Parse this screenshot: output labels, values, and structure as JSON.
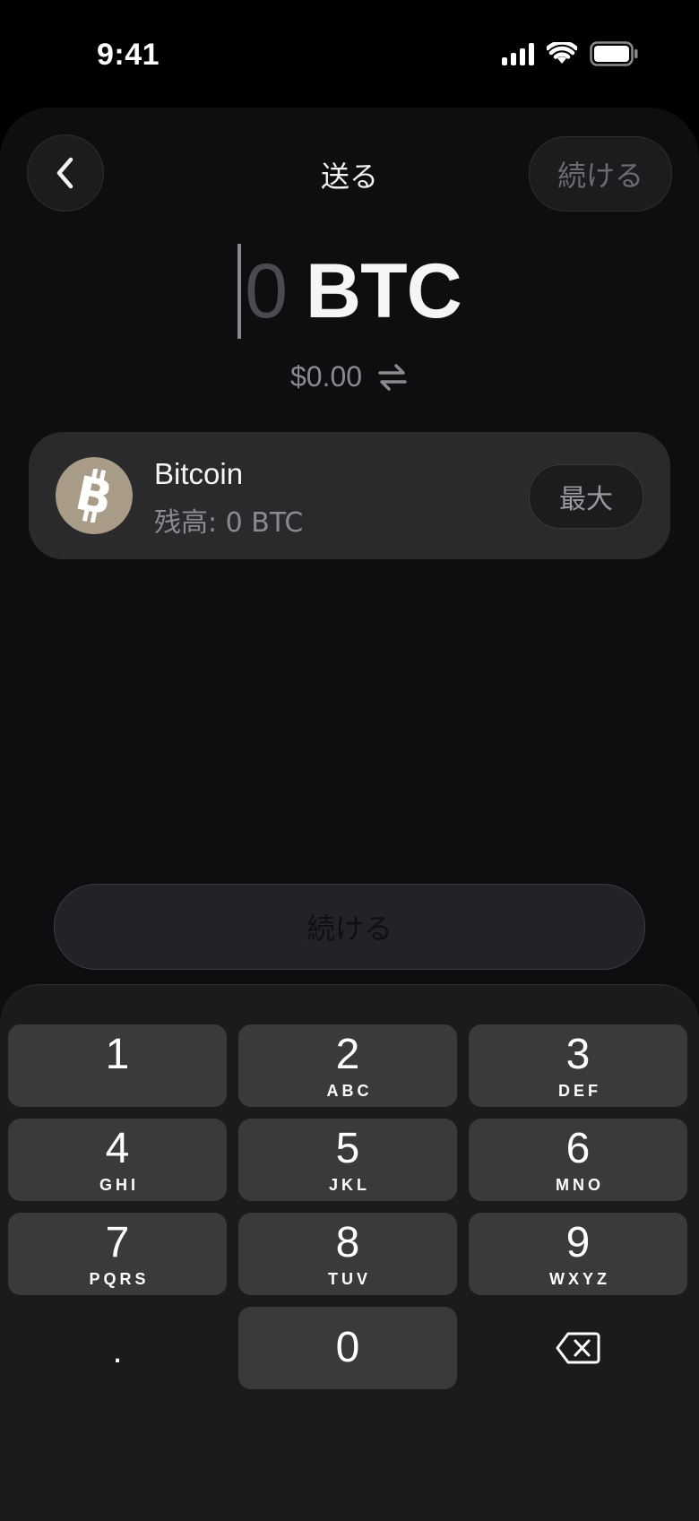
{
  "status": {
    "time": "9:41"
  },
  "nav": {
    "title": "送る",
    "continue_label": "続ける"
  },
  "amount": {
    "value": "0",
    "unit": "BTC",
    "fiat": "$0.00"
  },
  "asset": {
    "name": "Bitcoin",
    "balance": "残高: 0 BTC",
    "max_label": "最大",
    "logo_color": "#a89c88"
  },
  "main_button": {
    "label": "続ける"
  },
  "keypad": {
    "keys": [
      {
        "digit": "1",
        "letters": ""
      },
      {
        "digit": "2",
        "letters": "ABC"
      },
      {
        "digit": "3",
        "letters": "DEF"
      },
      {
        "digit": "4",
        "letters": "GHI"
      },
      {
        "digit": "5",
        "letters": "JKL"
      },
      {
        "digit": "6",
        "letters": "MNO"
      },
      {
        "digit": "7",
        "letters": "PQRS"
      },
      {
        "digit": "8",
        "letters": "TUV"
      },
      {
        "digit": "9",
        "letters": "WXYZ"
      },
      {
        "digit": ".",
        "letters": ""
      },
      {
        "digit": "0",
        "letters": ""
      }
    ]
  },
  "icons": {
    "back": "chevron-left-icon",
    "swap": "swap-arrows-icon",
    "bitcoin": "bitcoin-icon",
    "delete": "backspace-icon",
    "signal": "cellular-signal-icon",
    "wifi": "wifi-icon",
    "battery": "battery-icon"
  }
}
